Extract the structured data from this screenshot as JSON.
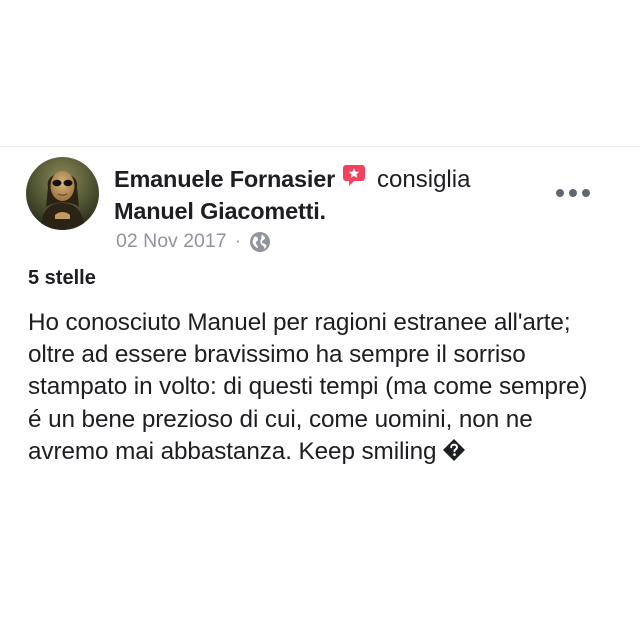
{
  "post": {
    "author": "Emanuele Fornasier",
    "action_verb": "consiglia",
    "recommended_page": "Manuel Giacometti.",
    "date": "02 Nov 2017",
    "separator": "·",
    "rating": "5 stelle",
    "body_lines": [
      "Ho conosciuto Manuel per ragioni estranee all'arte;",
      "oltre ad essere bravissimo ha sempre il sorriso",
      "stampato in volto: di questi tempi (ma come sempre)",
      "é un bene prezioso di cui, come uomini, non ne",
      "avremo mai abbastanza. Keep smiling"
    ]
  },
  "icons": {
    "recommendation_icon": "recommendation-badge-icon",
    "privacy_icon": "globe-icon",
    "more_icon": "more-options-icon",
    "missing_emoji": "replacement-character-icon"
  },
  "colors": {
    "text": "#1c1e21",
    "meta": "#90949c",
    "recommend_badge": "#f3425f"
  }
}
